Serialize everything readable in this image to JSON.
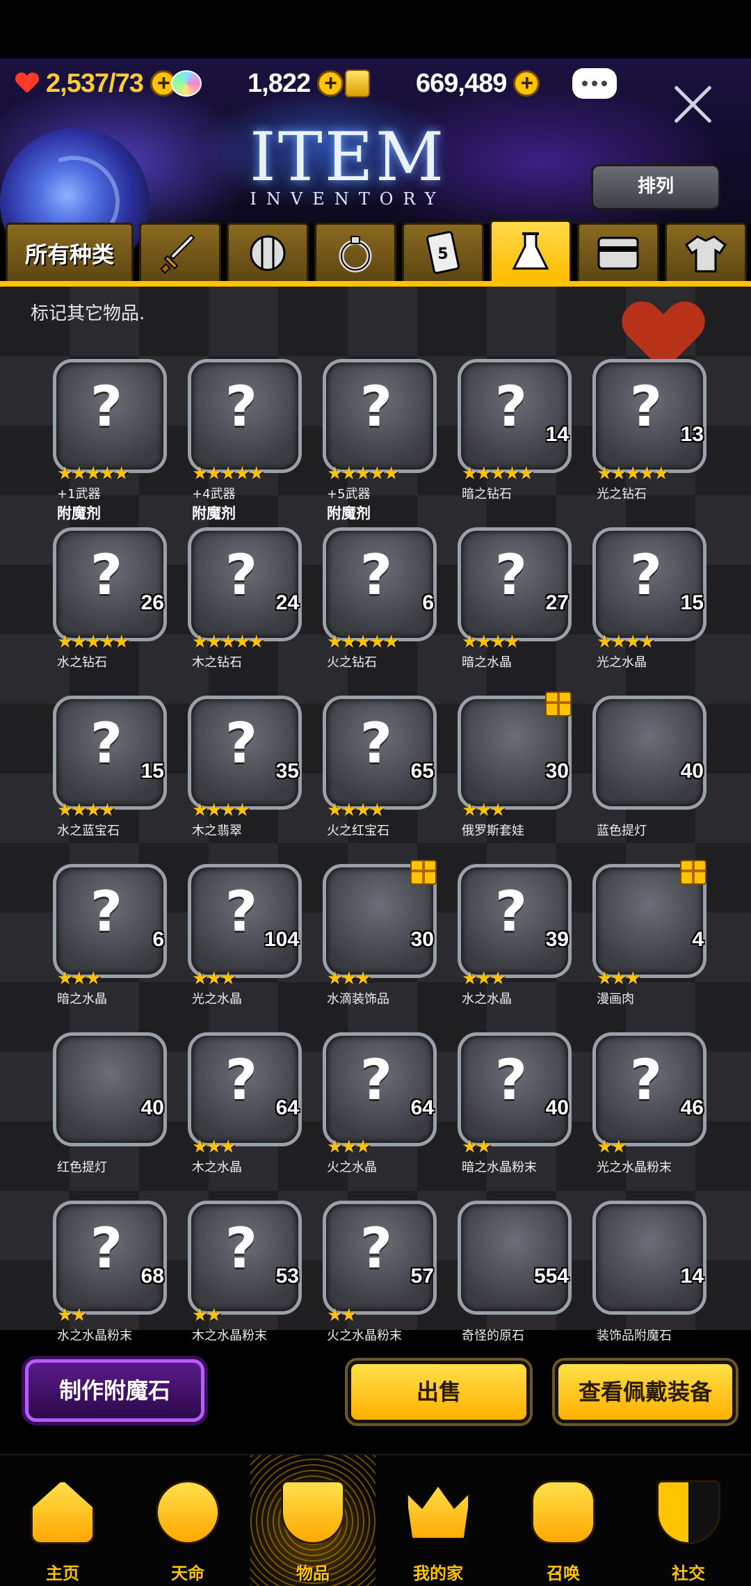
{
  "resources": {
    "stamina": "2,537/73",
    "gems": "1,822",
    "gold": "669,489"
  },
  "header": {
    "title": "ITEM",
    "subtitle": "INVENTORY",
    "sort_label": "排列"
  },
  "tabs": [
    {
      "label": "所有种类",
      "icon": "all-types"
    },
    {
      "label": "",
      "icon": "sword-icon"
    },
    {
      "label": "",
      "icon": "shield-icon"
    },
    {
      "label": "",
      "icon": "ring-icon"
    },
    {
      "label": "",
      "icon": "card-icon"
    },
    {
      "label": "",
      "icon": "potion-flask-icon"
    },
    {
      "label": "",
      "icon": "card-frame-icon"
    },
    {
      "label": "",
      "icon": "shirt-icon"
    }
  ],
  "hint": "标记其它物品.",
  "items": [
    {
      "stars": "★★★★★",
      "count": "",
      "name": "+1武器",
      "name2": "附魔剂",
      "art": "unknown"
    },
    {
      "stars": "★★★★★",
      "count": "",
      "name": "+4武器",
      "name2": "附魔剂",
      "art": "unknown"
    },
    {
      "stars": "★★★★★",
      "count": "",
      "name": "+5武器",
      "name2": "附魔剂",
      "art": "unknown"
    },
    {
      "stars": "★★★★★",
      "count": "14",
      "name": "暗之钻石",
      "name2": "",
      "art": "unknown"
    },
    {
      "stars": "★★★★★",
      "count": "13",
      "name": "光之钻石",
      "name2": "",
      "art": "unknown"
    },
    {
      "stars": "★★★★★",
      "count": "26",
      "name": "水之钻石",
      "name2": "",
      "art": "unknown"
    },
    {
      "stars": "★★★★★",
      "count": "24",
      "name": "木之钻石",
      "name2": "",
      "art": "unknown"
    },
    {
      "stars": "★★★★★",
      "count": "6",
      "name": "火之钻石",
      "name2": "",
      "art": "unknown"
    },
    {
      "stars": "★★★★",
      "count": "27",
      "name": "暗之水晶",
      "name2": "",
      "art": "unknown"
    },
    {
      "stars": "★★★★",
      "count": "15",
      "name": "光之水晶",
      "name2": "",
      "art": "unknown"
    },
    {
      "stars": "★★★★",
      "count": "15",
      "name": "水之蓝宝石",
      "name2": "",
      "art": "unknown"
    },
    {
      "stars": "★★★★",
      "count": "35",
      "name": "木之翡翠",
      "name2": "",
      "art": "unknown"
    },
    {
      "stars": "★★★★",
      "count": "65",
      "name": "火之红宝石",
      "name2": "",
      "art": "unknown"
    },
    {
      "stars": "★★★",
      "count": "30",
      "name": "俄罗斯套娃",
      "name2": "",
      "art": "doll",
      "gift": true
    },
    {
      "stars": "",
      "count": "40",
      "name": "蓝色提灯",
      "name2": "",
      "art": "lantern-blue"
    },
    {
      "stars": "★★★",
      "count": "6",
      "name": "暗之水晶",
      "name2": "",
      "art": "unknown"
    },
    {
      "stars": "★★★",
      "count": "104",
      "name": "光之水晶",
      "name2": "",
      "art": "unknown"
    },
    {
      "stars": "★★★",
      "count": "30",
      "name": "水滴装饰品",
      "name2": "",
      "art": "earring",
      "gift": true
    },
    {
      "stars": "★★★",
      "count": "39",
      "name": "水之水晶",
      "name2": "",
      "art": "unknown"
    },
    {
      "stars": "★★★",
      "count": "4",
      "name": "漫画肉",
      "name2": "",
      "art": "meat",
      "gift": true
    },
    {
      "stars": "",
      "count": "40",
      "name": "红色提灯",
      "name2": "",
      "art": "lantern-red"
    },
    {
      "stars": "★★★",
      "count": "64",
      "name": "木之水晶",
      "name2": "",
      "art": "unknown"
    },
    {
      "stars": "★★★",
      "count": "64",
      "name": "火之水晶",
      "name2": "",
      "art": "unknown"
    },
    {
      "stars": "★★",
      "count": "40",
      "name": "暗之水晶粉末",
      "name2": "",
      "art": "unknown"
    },
    {
      "stars": "★★",
      "count": "46",
      "name": "光之水晶粉末",
      "name2": "",
      "art": "unknown"
    },
    {
      "stars": "★★",
      "count": "68",
      "name": "水之水晶粉末",
      "name2": "",
      "art": "unknown"
    },
    {
      "stars": "★★",
      "count": "53",
      "name": "木之水晶粉末",
      "name2": "",
      "art": "unknown"
    },
    {
      "stars": "★★",
      "count": "57",
      "name": "火之水晶粉末",
      "name2": "",
      "art": "unknown"
    },
    {
      "stars": "",
      "count": "554",
      "name": "奇怪的原石",
      "name2": "",
      "art": "crystal"
    },
    {
      "stars": "",
      "count": "14",
      "name": "装饰品附魔石",
      "name2": "",
      "art": "gem-green"
    }
  ],
  "actions": {
    "craft": "制作附魔石",
    "sell": "出售",
    "view_equipped": "查看佩戴装备"
  },
  "nav": [
    {
      "label": "主页",
      "icon": "home-icon"
    },
    {
      "label": "天命",
      "icon": "fate-flame-icon"
    },
    {
      "label": "物品",
      "icon": "items-sword-shield-icon",
      "active": true
    },
    {
      "label": "我的家",
      "icon": "crown-laurel-icon"
    },
    {
      "label": "召唤",
      "icon": "summon-potion-icon"
    },
    {
      "label": "社交",
      "icon": "social-shield-icon"
    }
  ],
  "question_mark": "?"
}
